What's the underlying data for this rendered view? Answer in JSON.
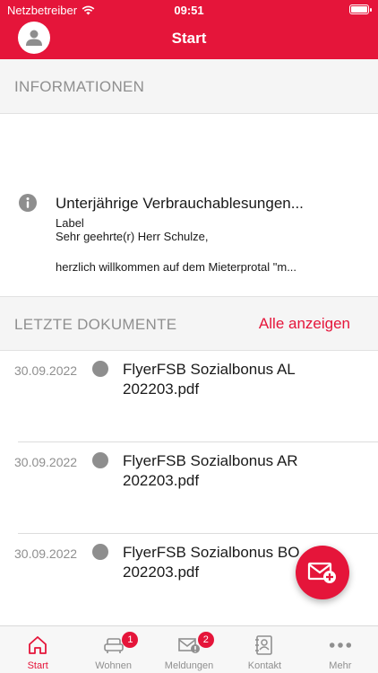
{
  "status_bar": {
    "carrier": "Netzbetreiber",
    "time": "09:51"
  },
  "header": {
    "title": "Start"
  },
  "informationen": {
    "section_title": "INFORMATIONEN",
    "item": {
      "title": "Unterjährige Verbrauchablesungen...",
      "label": "Label",
      "line1": "Sehr geehrte(r) Herr Schulze,",
      "line2": "herzlich willkommen auf dem Mieterprotal \"m..."
    }
  },
  "documents": {
    "section_title": "LETZTE DOKUMENTE",
    "show_all": "Alle anzeigen",
    "items": [
      {
        "date": "30.09.2022",
        "name": "FlyerFSB Sozialbonus AL 202203.pdf"
      },
      {
        "date": "30.09.2022",
        "name": "FlyerFSB Sozialbonus AR 202203.pdf"
      },
      {
        "date": "30.09.2022",
        "name": "FlyerFSB Sozialbonus BO 202203.pdf"
      }
    ]
  },
  "tabbar": {
    "tabs": [
      {
        "label": "Start",
        "icon": "home-icon",
        "active": true
      },
      {
        "label": "Wohnen",
        "icon": "sofa-icon",
        "badge": "1"
      },
      {
        "label": "Meldungen",
        "icon": "mail-alert-icon",
        "badge": "2"
      },
      {
        "label": "Kontakt",
        "icon": "contact-book-icon"
      },
      {
        "label": "Mehr",
        "icon": "more-dots-icon"
      }
    ]
  },
  "colors": {
    "brand": "#e5153a",
    "muted_text": "#8f8f8f",
    "section_bg": "#f5f5f5"
  }
}
